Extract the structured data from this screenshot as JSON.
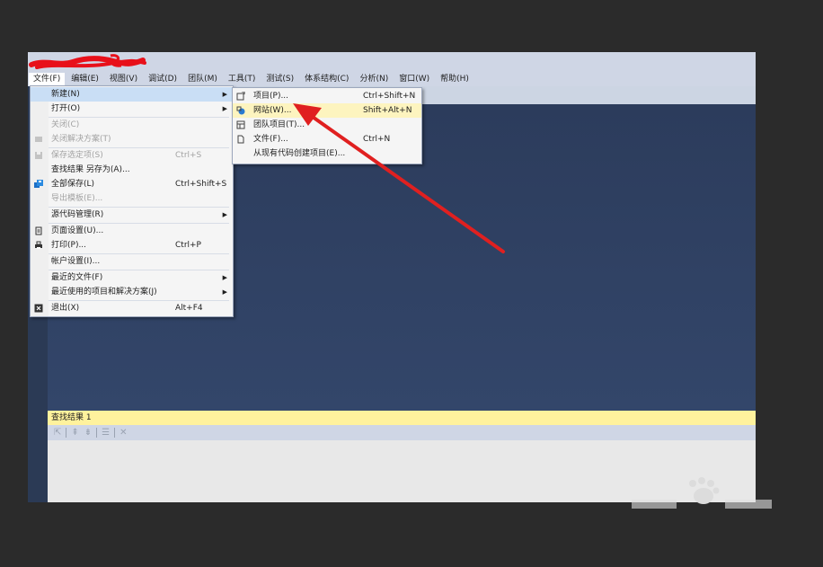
{
  "menubar": {
    "items": [
      "文件(F)",
      "编辑(E)",
      "视图(V)",
      "调试(D)",
      "团队(M)",
      "工具(T)",
      "测试(S)",
      "体系结构(C)",
      "分析(N)",
      "窗口(W)",
      "帮助(H)"
    ]
  },
  "file_menu": {
    "new": "新建(N)",
    "open": "打开(O)",
    "close": "关闭(C)",
    "close_solution": "关闭解决方案(T)",
    "save_selected": "保存选定项(S)",
    "save_selected_shortcut": "Ctrl+S",
    "save_find_results": "查找结果 另存为(A)...",
    "save_all": "全部保存(L)",
    "save_all_shortcut": "Ctrl+Shift+S",
    "export_template": "导出模板(E)...",
    "source_control": "源代码管理(R)",
    "page_setup": "页面设置(U)...",
    "print": "打印(P)...",
    "print_shortcut": "Ctrl+P",
    "account_settings": "帐户设置(I)...",
    "recent_files": "最近的文件(F)",
    "recent_projects": "最近使用的项目和解决方案(J)",
    "exit": "退出(X)",
    "exit_shortcut": "Alt+F4"
  },
  "new_menu": {
    "project": "项目(P)...",
    "project_shortcut": "Ctrl+Shift+N",
    "website": "网站(W)...",
    "website_shortcut": "Shift+Alt+N",
    "team_project": "团队项目(T)...",
    "file": "文件(F)...",
    "file_shortcut": "Ctrl+N",
    "from_existing_code": "从现有代码创建项目(E)..."
  },
  "find_panel": {
    "title": "查找结果 1"
  },
  "colors": {
    "editor_bg": "#33466a",
    "menubar_bg": "#cfd6e5",
    "highlight": "#fdf4bf",
    "find_title_bg": "#fff29d",
    "annotation_arrow": "#e02020"
  }
}
